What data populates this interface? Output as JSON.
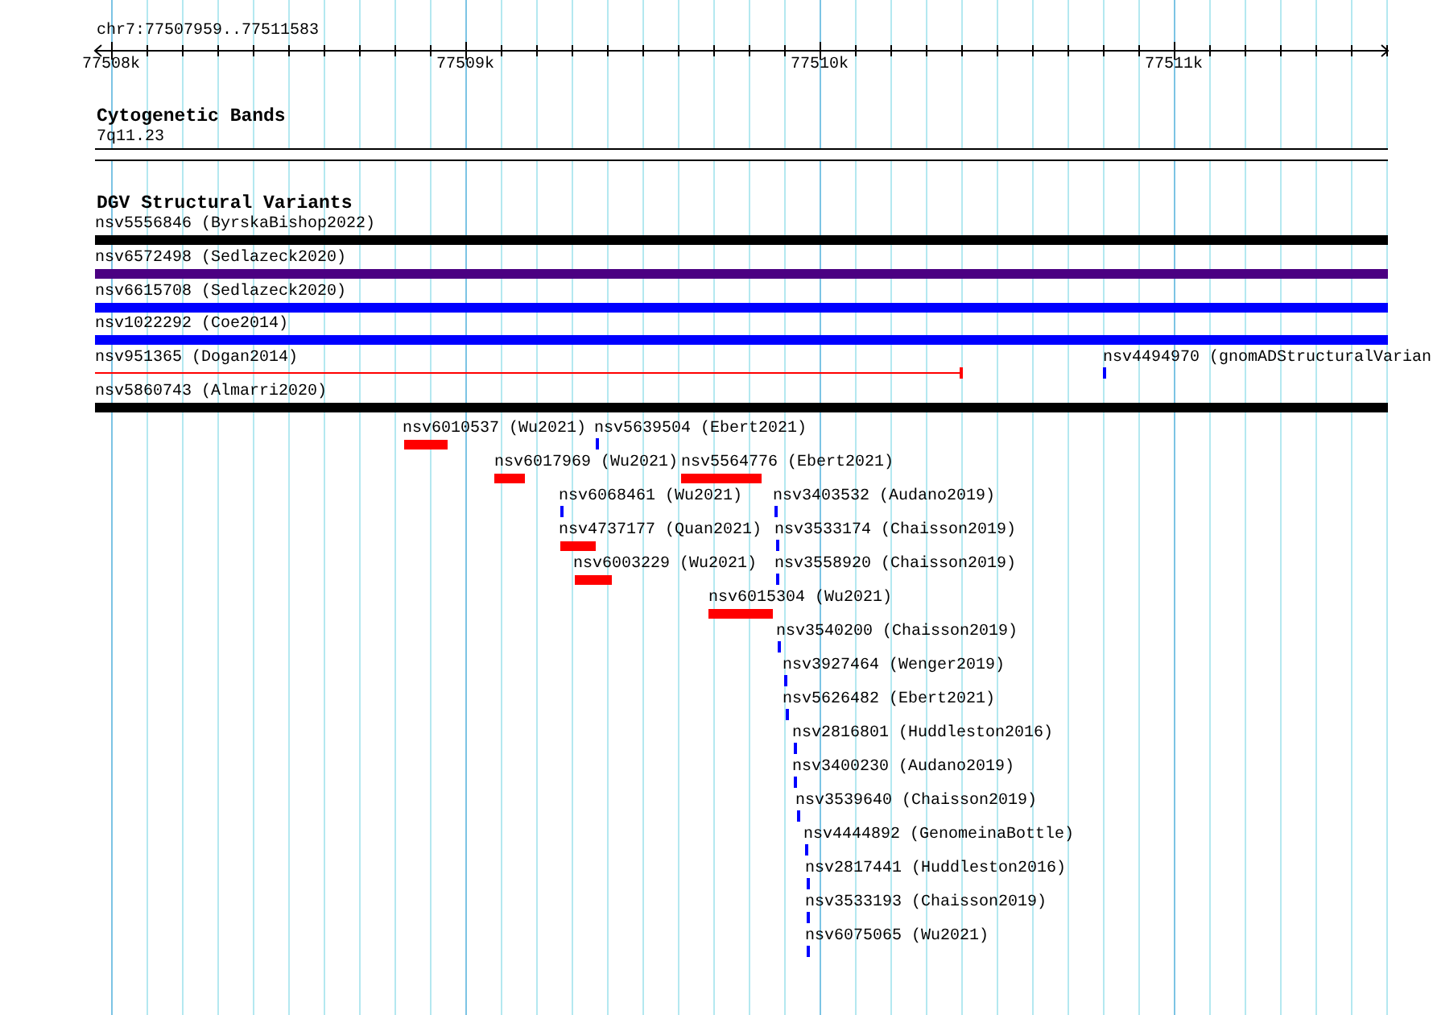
{
  "ruler": {
    "title": "chr7:77507959..77511583",
    "tick_labels": [
      "77508k",
      "77509k",
      "77510k",
      "77511k"
    ]
  },
  "cytogenetic_bands": {
    "title": "Cytogenetic Bands",
    "band": "7q11.23"
  },
  "dgv_structural_variants": {
    "title": "DGV Structural Variants",
    "features": [
      {
        "label": "nsv5556846 (ByrskaBishop2022)",
        "kind": "bar",
        "color": "#000000"
      },
      {
        "label": "nsv6572498 (Sedlazeck2020)",
        "kind": "bar",
        "color": "#4b0082"
      },
      {
        "label": "nsv6615708 (Sedlazeck2020)",
        "kind": "bar",
        "color": "#0000ff"
      },
      {
        "label": "nsv1022292 (Coe2014)",
        "kind": "bar",
        "color": "#0000ff"
      },
      {
        "label": "nsv951365 (Dogan2014)",
        "kind": "line",
        "color": "#ff0000"
      },
      {
        "label": "nsv4494970 (gnomADStructuralVarian",
        "kind": "tick",
        "color": "#0000ff"
      },
      {
        "label": "nsv5860743 (Almarri2020)",
        "kind": "bar",
        "color": "#000000"
      },
      {
        "label": "nsv6010537 (Wu2021)",
        "kind": "bar",
        "color": "#ff0000"
      },
      {
        "label": "nsv5639504 (Ebert2021)",
        "kind": "tick",
        "color": "#0000ff"
      },
      {
        "label": "nsv6017969 (Wu2021)",
        "kind": "bar",
        "color": "#ff0000"
      },
      {
        "label": "nsv5564776 (Ebert2021)",
        "kind": "bar",
        "color": "#ff0000"
      },
      {
        "label": "nsv6068461 (Wu2021)",
        "kind": "tick",
        "color": "#0000ff"
      },
      {
        "label": "nsv3403532 (Audano2019)",
        "kind": "tick",
        "color": "#0000ff"
      },
      {
        "label": "nsv4737177 (Quan2021)",
        "kind": "bar",
        "color": "#ff0000"
      },
      {
        "label": "nsv3533174 (Chaisson2019)",
        "kind": "tick",
        "color": "#0000ff"
      },
      {
        "label": "nsv6003229 (Wu2021)",
        "kind": "bar",
        "color": "#ff0000"
      },
      {
        "label": "nsv3558920 (Chaisson2019)",
        "kind": "tick",
        "color": "#0000ff"
      },
      {
        "label": "nsv6015304 (Wu2021)",
        "kind": "bar",
        "color": "#ff0000"
      },
      {
        "label": "nsv3540200 (Chaisson2019)",
        "kind": "tick",
        "color": "#0000ff"
      },
      {
        "label": "nsv3927464 (Wenger2019)",
        "kind": "tick",
        "color": "#0000ff"
      },
      {
        "label": "nsv5626482 (Ebert2021)",
        "kind": "tick",
        "color": "#0000ff"
      },
      {
        "label": "nsv2816801 (Huddleston2016)",
        "kind": "tick",
        "color": "#0000ff"
      },
      {
        "label": "nsv3400230 (Audano2019)",
        "kind": "tick",
        "color": "#0000ff"
      },
      {
        "label": "nsv3539640 (Chaisson2019)",
        "kind": "tick",
        "color": "#0000ff"
      },
      {
        "label": "nsv4444892 (GenomeinaBottle)",
        "kind": "tick",
        "color": "#0000ff"
      },
      {
        "label": "nsv2817441 (Huddleston2016)",
        "kind": "tick",
        "color": "#0000ff"
      },
      {
        "label": "nsv3533193 (Chaisson2019)",
        "kind": "tick",
        "color": "#0000ff"
      },
      {
        "label": "nsv6075065 (Wu2021)",
        "kind": "tick",
        "color": "#0000ff"
      }
    ]
  }
}
